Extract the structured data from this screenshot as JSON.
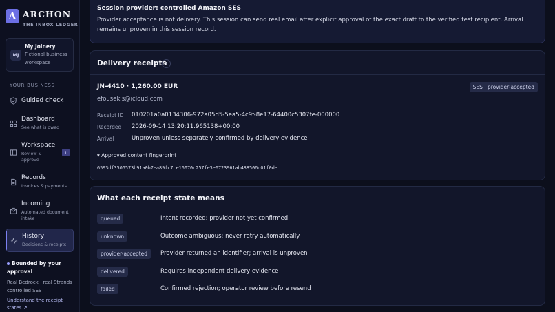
{
  "brand": {
    "logo": "A",
    "name": "ARCHON",
    "subtitle": "THE INBOX LEDGER"
  },
  "workspace": {
    "initials": "MJ",
    "name": "My Joinery",
    "description": "Fictional business workspace"
  },
  "sidebar": {
    "section_label": "YOUR BUSINESS",
    "items": [
      {
        "label": "Guided check",
        "sub": "",
        "icon": "shield-check-icon"
      },
      {
        "label": "Dashboard",
        "sub": "See what is owed",
        "icon": "grid-icon"
      },
      {
        "label": "Workspace",
        "sub": "Review & approve",
        "badge": "1",
        "icon": "columns-icon"
      },
      {
        "label": "Records",
        "sub": "Invoices & payments",
        "icon": "document-icon"
      },
      {
        "label": "Incoming",
        "sub": "Automated document intake",
        "icon": "inbox-icon"
      },
      {
        "label": "History",
        "sub": "Decisions & receipts",
        "icon": "activity-icon",
        "active": true
      }
    ]
  },
  "bounded": {
    "title": "Bounded by your approval",
    "text": "Real Bedrock · real Strands · controlled SES",
    "link": "Understand the receipt states ↗"
  },
  "provider_notice": {
    "title": "Session provider: controlled Amazon SES",
    "text": "Provider acceptance is not delivery. This session can send real email after explicit approval of the exact draft to the verified test recipient. Arrival remains unproven in this session record."
  },
  "receipts": {
    "title": "Delivery receipts",
    "count": "1",
    "item": {
      "heading": "JN-4410 · 1,260.00 EUR",
      "status": "SES · provider-accepted",
      "email": "efousekis@icloud.com",
      "fields": [
        {
          "label": "Receipt ID",
          "value": "010201a0a0134306-972a05d5-5ea5-4c9f-8e17-64400c5307fe-000000"
        },
        {
          "label": "Recorded",
          "value": "2026-09-14 13:20:11.965138+00:00"
        },
        {
          "label": "Arrival",
          "value": "Unproven unless separately confirmed by delivery evidence"
        }
      ],
      "fingerprint_toggle": "▾ Approved content fingerprint",
      "fingerprint": "6593df3505573b91a0b7ea89fc7ce16070c257fe3e6723961ab488506d01f0de"
    }
  },
  "states": {
    "title": "What each receipt state means",
    "rows": [
      {
        "chip": "queued",
        "desc": "Intent recorded; provider not yet confirmed"
      },
      {
        "chip": "unknown",
        "desc": "Outcome ambiguous; never retry automatically"
      },
      {
        "chip": "provider-accepted",
        "desc": "Provider returned an identifier; arrival is unproven"
      },
      {
        "chip": "delivered",
        "desc": "Requires independent delivery evidence"
      },
      {
        "chip": "failed",
        "desc": "Confirmed rejection; operator review before resend"
      }
    ]
  }
}
